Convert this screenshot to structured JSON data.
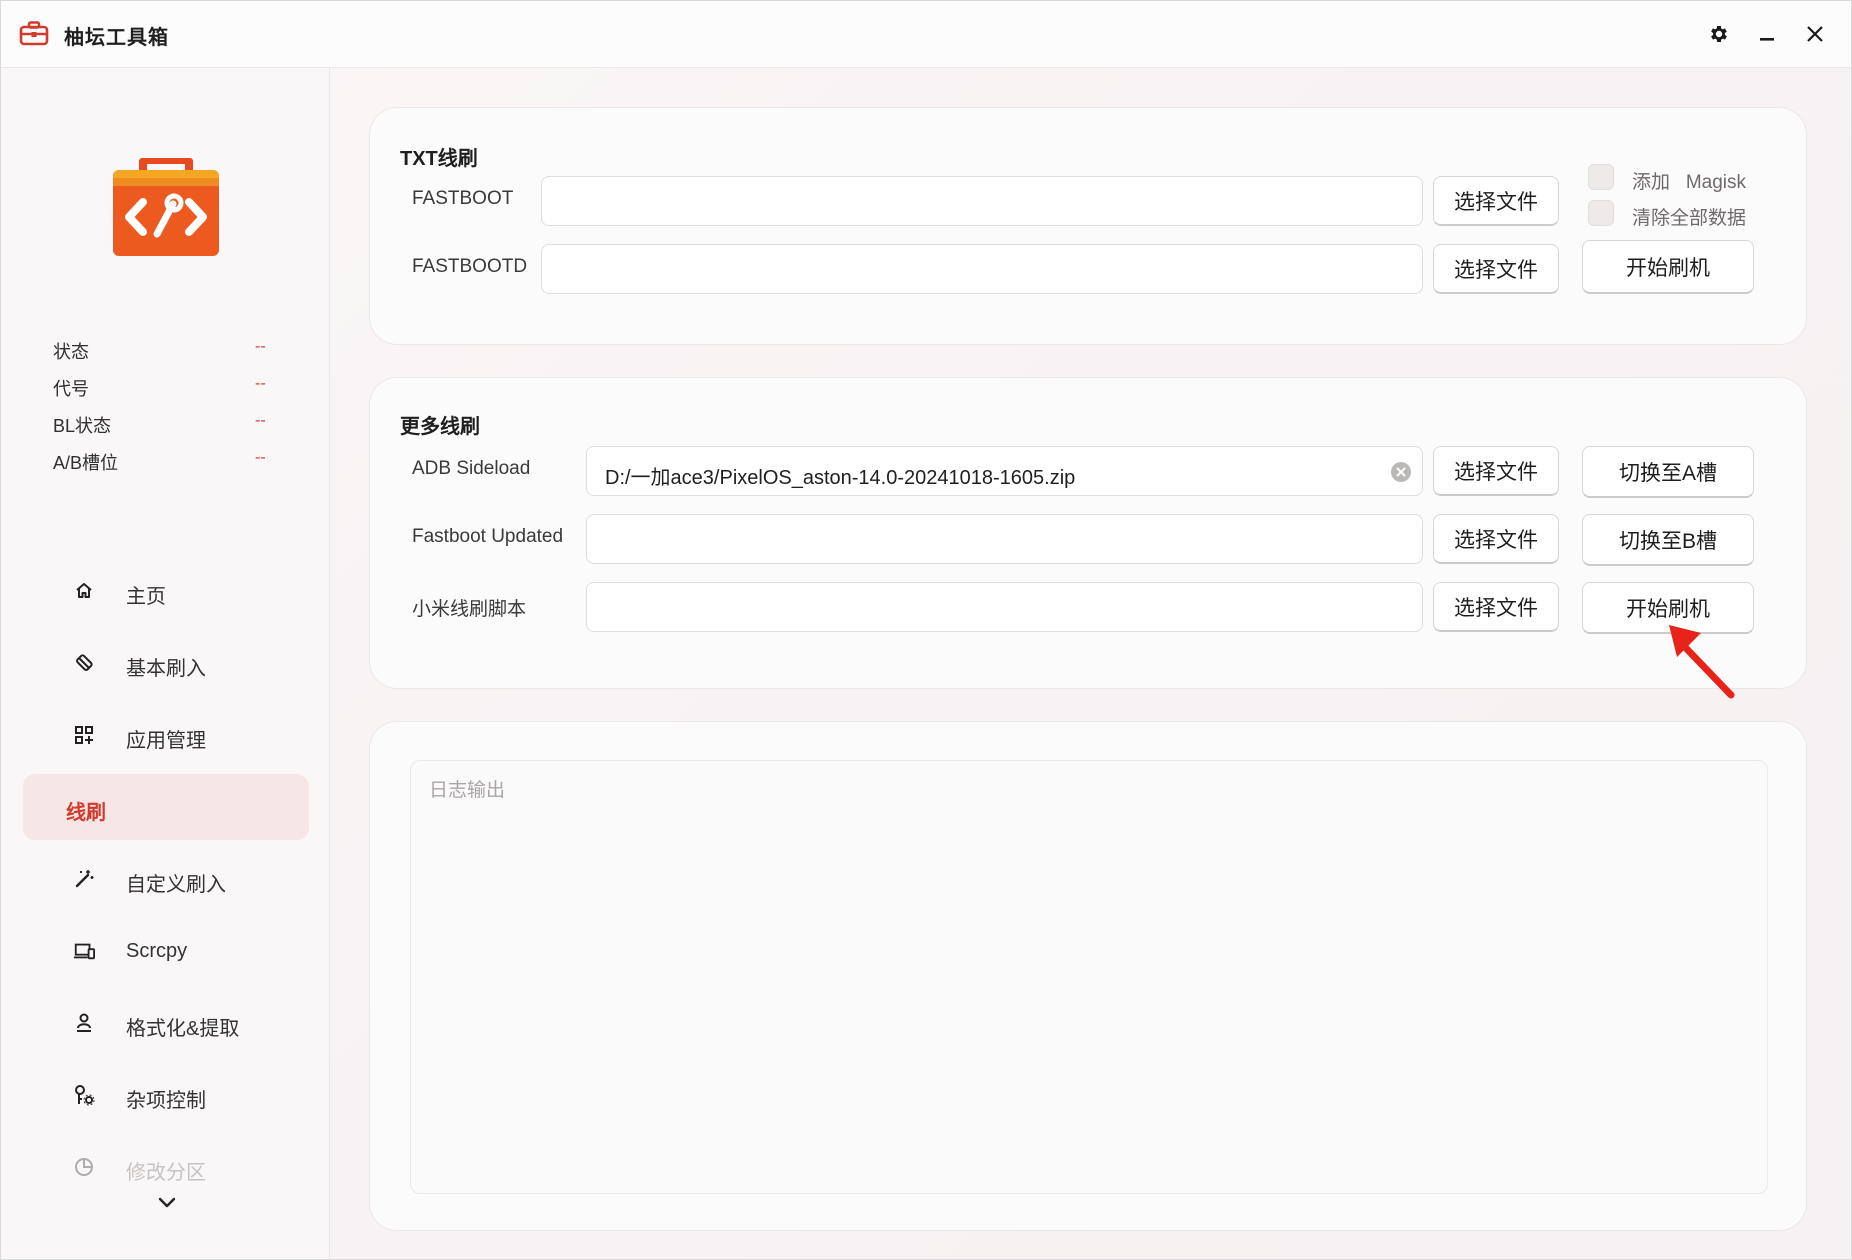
{
  "window": {
    "title": "柚坛工具箱"
  },
  "titlebar": {
    "settings_icon": "gear-icon",
    "minimize_icon": "minimize-icon",
    "close_icon": "close-icon"
  },
  "sidebar": {
    "logo_icon": "toolbox-code-icon",
    "info": [
      {
        "label": "状态",
        "value": "--"
      },
      {
        "label": "代号",
        "value": "--"
      },
      {
        "label": "BL状态",
        "value": "--"
      },
      {
        "label": "A/B槽位",
        "value": "--"
      }
    ],
    "nav": [
      {
        "label": "主页",
        "icon": "home-icon",
        "active": false
      },
      {
        "label": "基本刷入",
        "icon": "flash-icon",
        "active": false
      },
      {
        "label": "应用管理",
        "icon": "apps-icon",
        "active": false
      },
      {
        "label": "线刷",
        "icon": "",
        "active": true
      },
      {
        "label": "自定义刷入",
        "icon": "magic-wand-icon",
        "active": false
      },
      {
        "label": "Scrcpy",
        "icon": "screen-mirror-icon",
        "active": false
      },
      {
        "label": "格式化&提取",
        "icon": "person-stamp-icon",
        "active": false
      },
      {
        "label": "杂项控制",
        "icon": "wrench-gear-icon",
        "active": false
      },
      {
        "label": "修改分区",
        "icon": "pie-chart-icon",
        "active": false
      }
    ],
    "bottom_icons": [
      "terminal-icon",
      "github-icon",
      "chat-icon"
    ],
    "accent_color": "#d23a2e"
  },
  "txt_flash": {
    "title": "TXT线刷",
    "rows": [
      {
        "label": "FASTBOOT",
        "value": "",
        "button": "选择文件"
      },
      {
        "label": "FASTBOOTD",
        "value": "",
        "button": "选择文件"
      }
    ],
    "options": [
      {
        "label": "添加   Magisk",
        "checked": false
      },
      {
        "label": "清除全部数据",
        "checked": false
      }
    ],
    "start_button": "开始刷机"
  },
  "more_flash": {
    "title": "更多线刷",
    "rows": [
      {
        "label": "ADB Sideload",
        "value": "D:/一加ace3/PixelOS_aston-14.0-20241018-1605.zip",
        "button": "选择文件",
        "side_button": "切换至A槽"
      },
      {
        "label": "Fastboot Updated",
        "value": "",
        "button": "选择文件",
        "side_button": "切换至B槽"
      },
      {
        "label": "小米线刷脚本",
        "value": "",
        "button": "选择文件",
        "side_button": "开始刷机"
      }
    ]
  },
  "log": {
    "placeholder": "日志输出"
  }
}
